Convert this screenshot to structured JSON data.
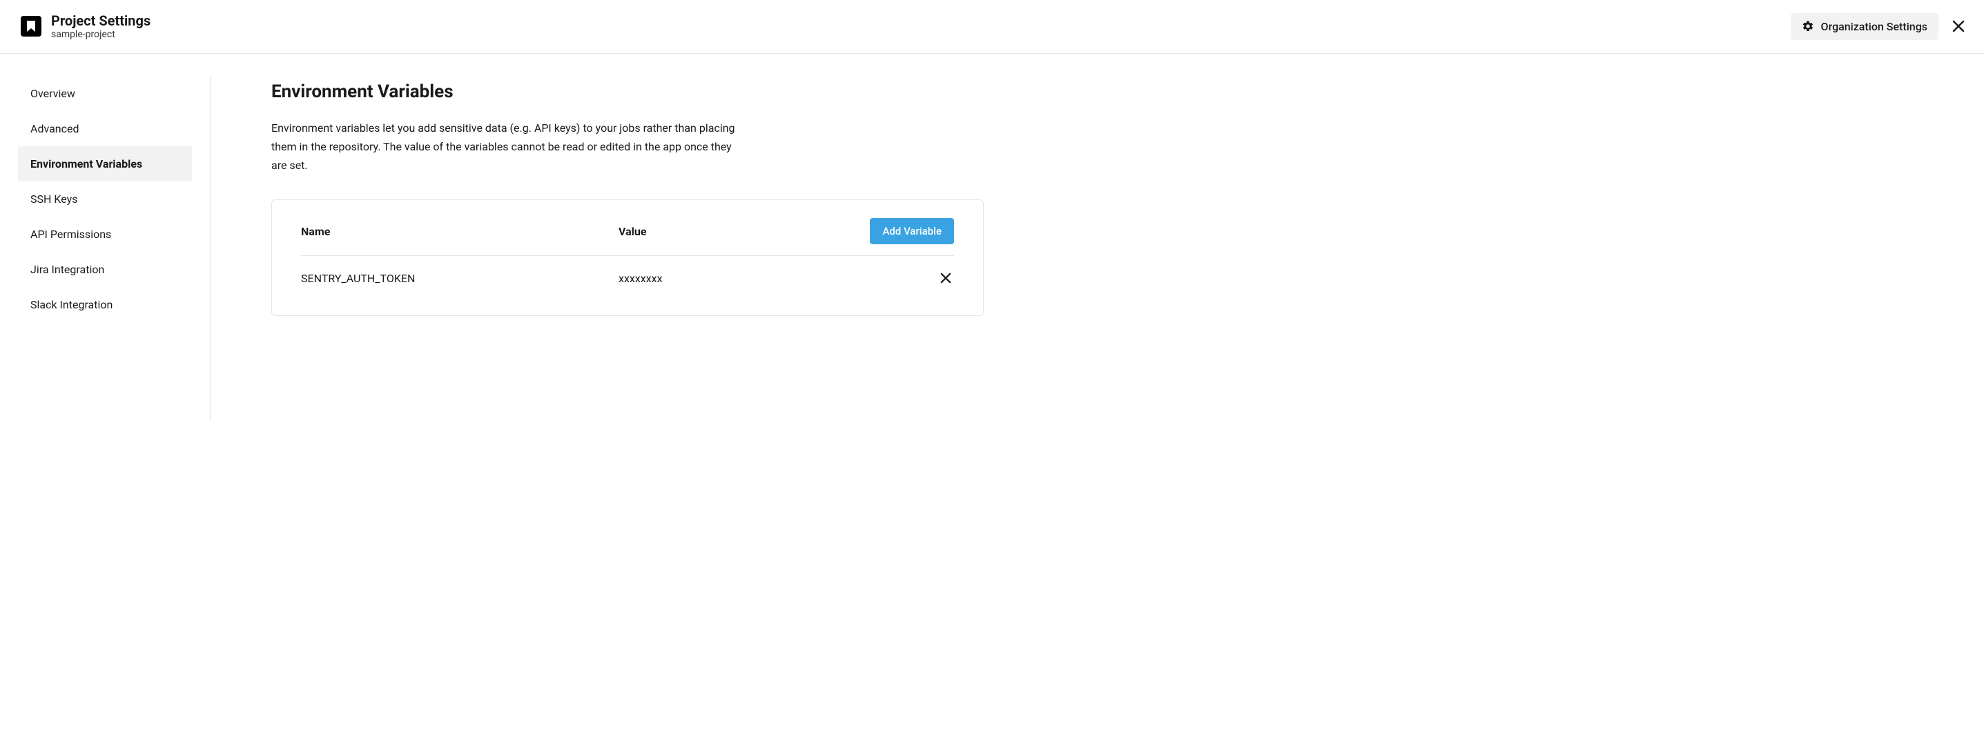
{
  "header": {
    "title": "Project Settings",
    "subtitle": "sample-project",
    "org_settings_label": "Organization Settings"
  },
  "sidebar": {
    "items": [
      {
        "label": "Overview",
        "active": false
      },
      {
        "label": "Advanced",
        "active": false
      },
      {
        "label": "Environment Variables",
        "active": true
      },
      {
        "label": "SSH Keys",
        "active": false
      },
      {
        "label": "API Permissions",
        "active": false
      },
      {
        "label": "Jira Integration",
        "active": false
      },
      {
        "label": "Slack Integration",
        "active": false
      }
    ]
  },
  "main": {
    "title": "Environment Variables",
    "description": "Environment variables let you add sensitive data (e.g. API keys) to your jobs rather than placing them in the repository. The value of the variables cannot be read or edited in the app once they are set.",
    "table": {
      "col_name": "Name",
      "col_value": "Value",
      "add_button": "Add Variable",
      "rows": [
        {
          "name": "SENTRY_AUTH_TOKEN",
          "value": "xxxxxxxx"
        }
      ]
    }
  }
}
